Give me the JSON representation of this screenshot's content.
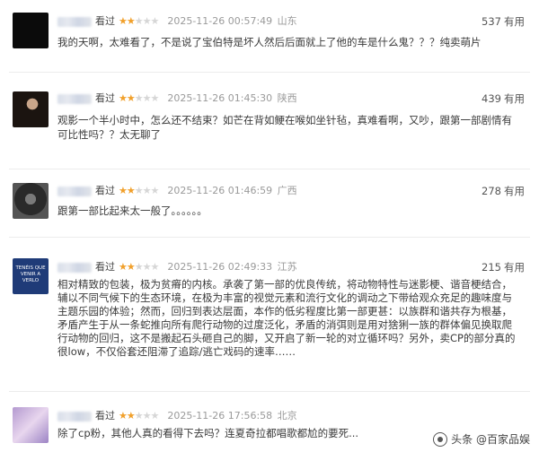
{
  "reviews": [
    {
      "status": "看过",
      "stars_on": "★★",
      "stars_off": "★★★",
      "time": "2025-11-26 00:57:49",
      "location": "山东",
      "votes": "537",
      "useful": "有用",
      "text": "我的天啊，太难看了，不是说了宝伯特是坏人然后后面就上了他的车是什么鬼？？？纯卖萌片"
    },
    {
      "status": "看过",
      "stars_on": "★★",
      "stars_off": "★★★",
      "time": "2025-11-26 01:45:30",
      "location": "陕西",
      "votes": "439",
      "useful": "有用",
      "text": "观影一个半小时中，怎么还不结束？如芒在背如鲠在喉如坐针毡，真难看啊，又吵，跟第一部剧情有可比性吗？？太无聊了"
    },
    {
      "status": "看过",
      "stars_on": "★★",
      "stars_off": "★★★",
      "time": "2025-11-26 01:46:59",
      "location": "广西",
      "votes": "278",
      "useful": "有用",
      "text": "跟第一部比起来太一般了。。。。。。"
    },
    {
      "status": "看过",
      "stars_on": "★★",
      "stars_off": "★★★",
      "time": "2025-11-26 02:49:33",
      "location": "江苏",
      "votes": "215",
      "useful": "有用",
      "avatar_text": "TENÉIS QUE VENIR A VERLO",
      "text": "相对精致的包装，极为贫瘠的内核。承袭了第一部的优良传统，将动物特性与迷影梗、谐音梗结合，辅以不同气候下的生态环境，在极为丰富的视觉元素和流行文化的调动之下带给观众充足的趣味度与主题乐园的体验；然而，回归到表达层面，本作的低劣程度比第一部更甚：以族群和谐共存为根基，矛盾产生于从一条蛇推向所有爬行动物的过度泛化，矛盾的消弭则是用对猞猁一族的群体偏见换取爬行动物的回归，这不是搬起石头砸自己的脚，又开启了新一轮的对立循环吗？另外，卖CP的部分真的很low，不仅俗套还阻滞了追踪/逃亡戏码的速率……"
    },
    {
      "status": "看过",
      "stars_on": "★★",
      "stars_off": "★★★",
      "time": "2025-11-26 17:56:58",
      "location": "北京",
      "votes": "",
      "useful": "",
      "text": "除了cp粉，其他人真的看得下去吗？连夏奇拉都唱歌都尬的要死..."
    }
  ],
  "watermark": {
    "text": "头条 @百家品娱"
  }
}
